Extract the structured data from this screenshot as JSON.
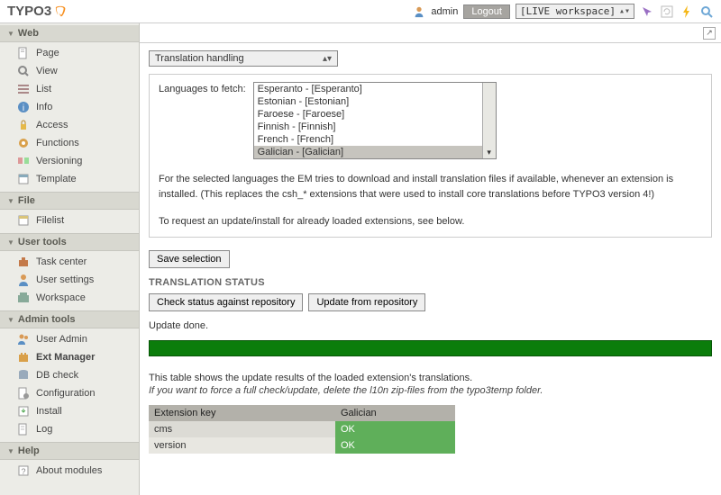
{
  "header": {
    "logo_text": "TYPO3",
    "username": "admin",
    "logout": "Logout",
    "workspace": "[LIVE workspace]"
  },
  "sidebar": {
    "sections": [
      {
        "title": "Web",
        "items": [
          "Page",
          "View",
          "List",
          "Info",
          "Access",
          "Functions",
          "Versioning",
          "Template"
        ]
      },
      {
        "title": "File",
        "items": [
          "Filelist"
        ]
      },
      {
        "title": "User tools",
        "items": [
          "Task center",
          "User settings",
          "Workspace"
        ]
      },
      {
        "title": "Admin tools",
        "items": [
          "User Admin",
          "Ext Manager",
          "DB check",
          "Configuration",
          "Install",
          "Log"
        ],
        "active": "Ext Manager"
      },
      {
        "title": "Help",
        "items": [
          "About modules"
        ]
      }
    ]
  },
  "main": {
    "dropdown": "Translation handling",
    "lang_label": "Languages to fetch:",
    "languages": [
      "Esperanto - [Esperanto]",
      "Estonian - [Estonian]",
      "Faroese - [Faroese]",
      "Finnish - [Finnish]",
      "French - [French]",
      "Galician - [Galician]"
    ],
    "selected_language": "Galician - [Galician]",
    "help1": "For the selected languages the EM tries to download and install translation files if available, whenever an extension is installed. (This replaces the csh_* extensions that were used to install core translations before TYPO3 version 4!)",
    "help2": "To request an update/install for already loaded extensions, see below.",
    "save_btn": "Save selection",
    "status_title": "TRANSLATION STATUS",
    "check_btn": "Check status against repository",
    "update_btn": "Update from repository",
    "done": "Update done.",
    "result_intro": "This table shows the update results of the loaded extension's translations.",
    "result_note": "If you want to force a full check/update, delete the l10n zip-files from the typo3temp folder.",
    "table": {
      "col1": "Extension key",
      "col2": "Galician",
      "rows": [
        {
          "key": "cms",
          "status": "OK"
        },
        {
          "key": "version",
          "status": "OK"
        }
      ]
    }
  },
  "colors": {
    "accent": "#f78f1e",
    "ok": "#5faf5a",
    "progress": "#0b7d0b"
  }
}
